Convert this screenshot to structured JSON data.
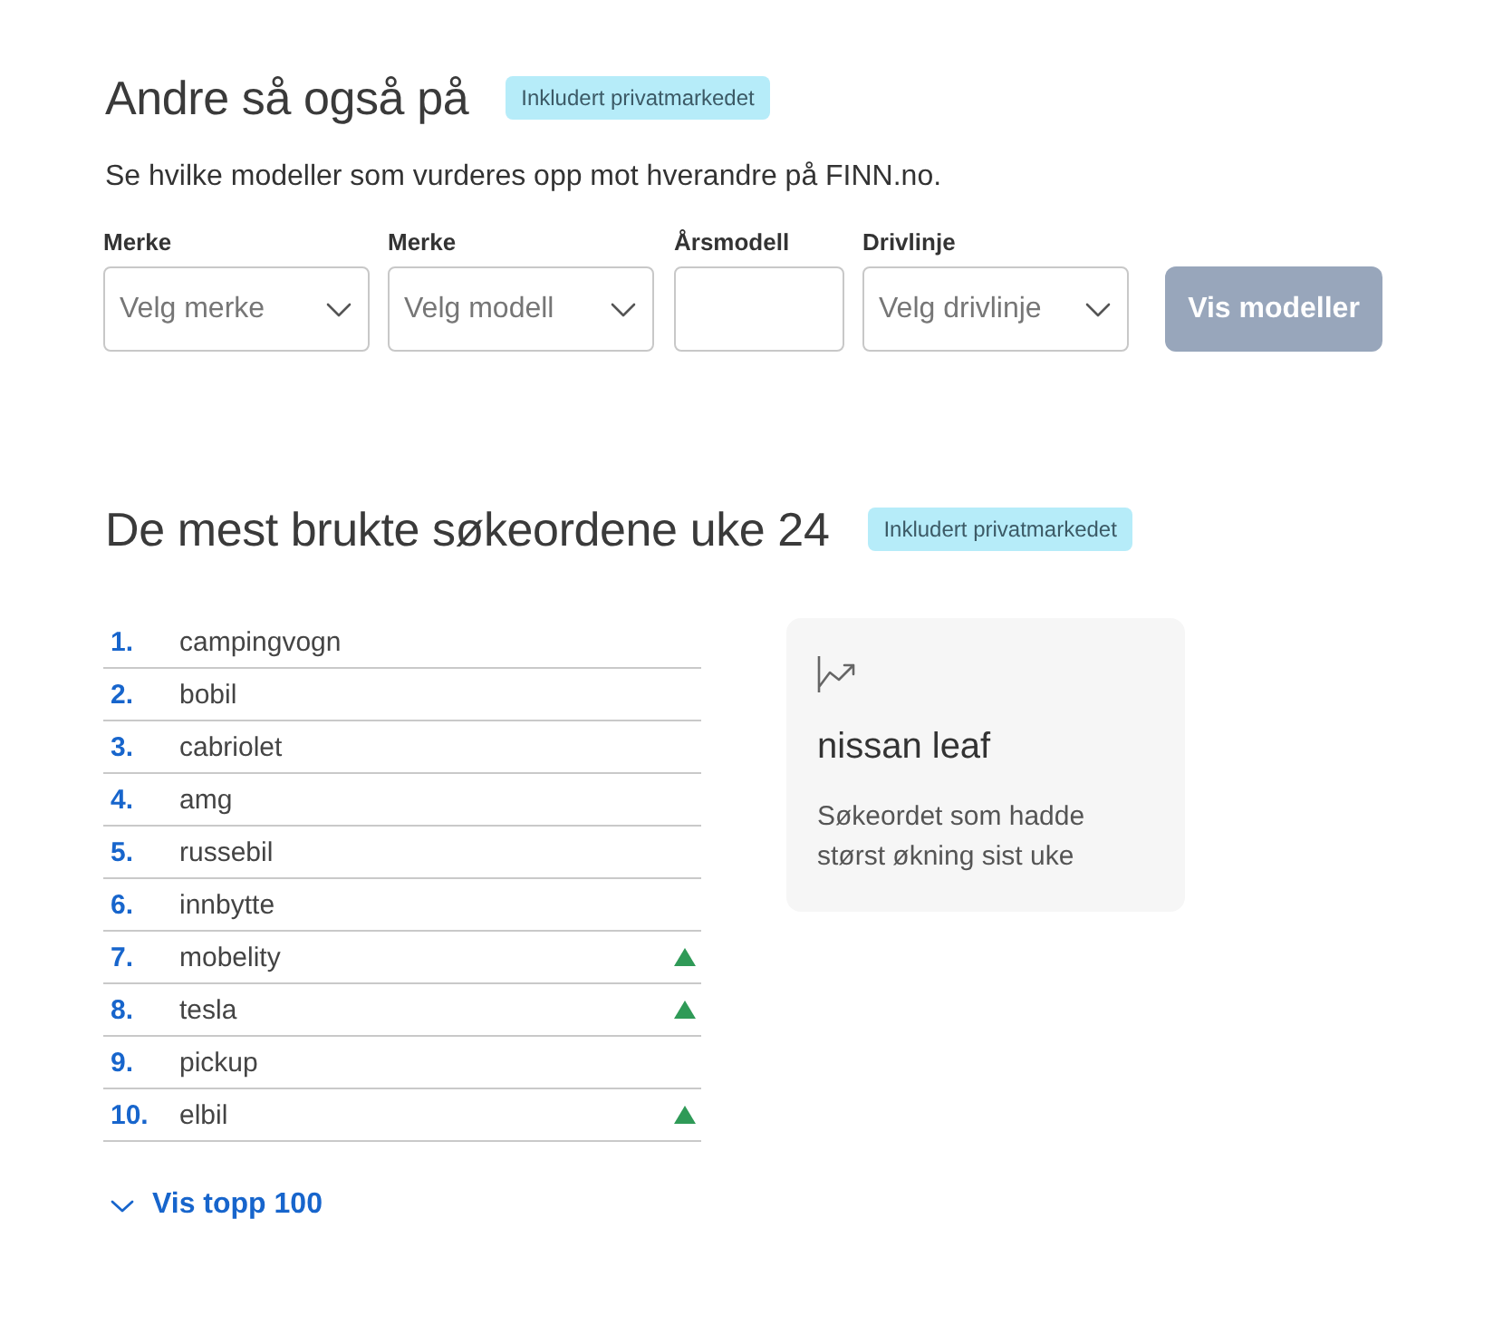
{
  "compare": {
    "title": "Andre så også på",
    "badge": "Inkludert privatmarkedet",
    "description": "Se hvilke modeller som vurderes opp mot hverandre på FINN.no.",
    "fields": [
      {
        "kind": "select",
        "label": "Merke",
        "placeholder": "Velg merke"
      },
      {
        "kind": "select",
        "label": "Merke",
        "placeholder": "Velg modell"
      },
      {
        "kind": "input",
        "label": "Årsmodell"
      },
      {
        "kind": "select",
        "label": "Drivlinje",
        "placeholder": "Velg drivlinje"
      }
    ],
    "button": {
      "label": "Vis modeller",
      "disabled": true
    }
  },
  "top_searches": {
    "title": "De mest brukte søkeordene uke 24",
    "badge": "Inkludert privatmarkedet",
    "items": [
      {
        "rank": "1.",
        "term": "campingvogn",
        "rising": false
      },
      {
        "rank": "2.",
        "term": "bobil",
        "rising": false
      },
      {
        "rank": "3.",
        "term": "cabriolet",
        "rising": false
      },
      {
        "rank": "4.",
        "term": "amg",
        "rising": false
      },
      {
        "rank": "5.",
        "term": "russebil",
        "rising": false
      },
      {
        "rank": "6.",
        "term": "innbytte",
        "rising": false
      },
      {
        "rank": "7.",
        "term": "mobelity",
        "rising": true
      },
      {
        "rank": "8.",
        "term": "tesla",
        "rising": true
      },
      {
        "rank": "9.",
        "term": "pickup",
        "rising": false
      },
      {
        "rank": "10.",
        "term": "elbil",
        "rising": true
      }
    ],
    "show_more": "Vis topp 100",
    "highlight": {
      "term": "nissan leaf",
      "description": "Søkeordet som hadde størst økning sist uke"
    }
  }
}
